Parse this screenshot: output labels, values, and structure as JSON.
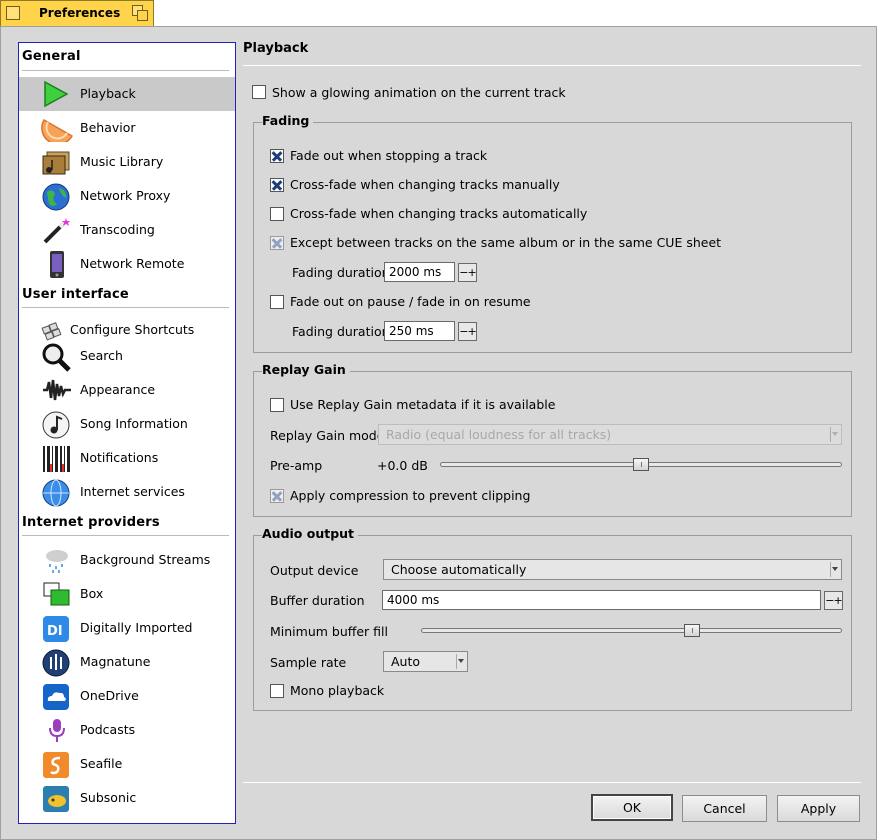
{
  "window": {
    "title": "Preferences"
  },
  "sidebar": {
    "sections": [
      {
        "title": "General",
        "items": [
          {
            "label": "Playback",
            "icon": "play-icon",
            "selected": true
          },
          {
            "label": "Behavior",
            "icon": "orange-slice-icon"
          },
          {
            "label": "Music Library",
            "icon": "music-folder-icon"
          },
          {
            "label": "Network Proxy",
            "icon": "globe-icon"
          },
          {
            "label": "Transcoding",
            "icon": "magic-wand-icon"
          },
          {
            "label": "Network Remote",
            "icon": "phone-icon"
          }
        ]
      },
      {
        "title": "User interface",
        "items": [
          {
            "label": "Configure Shortcuts",
            "icon": "keyboard-icon"
          },
          {
            "label": "Search",
            "icon": "magnifier-icon"
          },
          {
            "label": "Appearance",
            "icon": "waveform-icon"
          },
          {
            "label": "Song Information",
            "icon": "music-note-icon"
          },
          {
            "label": "Notifications",
            "icon": "barcode-icon"
          },
          {
            "label": "Internet services",
            "icon": "internet-globe-icon"
          }
        ]
      },
      {
        "title": "Internet providers",
        "items": [
          {
            "label": "Background Streams",
            "icon": "rain-cloud-icon"
          },
          {
            "label": "Box",
            "icon": "box-icon"
          },
          {
            "label": "Digitally Imported",
            "icon": "di-logo-icon"
          },
          {
            "label": "Magnatune",
            "icon": "magnatune-icon"
          },
          {
            "label": "OneDrive",
            "icon": "onedrive-icon"
          },
          {
            "label": "Podcasts",
            "icon": "podcast-icon"
          },
          {
            "label": "Seafile",
            "icon": "seafile-icon"
          },
          {
            "label": "Subsonic",
            "icon": "subsonic-icon"
          }
        ]
      }
    ]
  },
  "page": {
    "title": "Playback",
    "glowing_animation": {
      "label": "Show a glowing animation on the current track",
      "checked": false
    },
    "fading": {
      "title": "Fading",
      "fade_out_stop": {
        "label": "Fade out when stopping a track",
        "checked": true
      },
      "crossfade_manual": {
        "label": "Cross-fade when changing tracks manually",
        "checked": true
      },
      "crossfade_auto": {
        "label": "Cross-fade when changing tracks automatically",
        "checked": false
      },
      "except_album": {
        "label": "Except between tracks on the same album or in the same CUE sheet",
        "checked": true,
        "disabled": true
      },
      "duration_label": "Fading duration",
      "duration_value": "2000 ms",
      "fade_pause": {
        "label": "Fade out on pause / fade in on resume",
        "checked": false
      },
      "pause_duration_label": "Fading duration",
      "pause_duration_value": "250 ms",
      "spin_label": "−+"
    },
    "replay_gain": {
      "title": "Replay Gain",
      "use_metadata": {
        "label": "Use Replay Gain metadata if it is available",
        "checked": false
      },
      "mode_label": "Replay Gain mode",
      "mode_value": "Radio (equal loudness for all tracks)",
      "preamp_label": "Pre-amp",
      "preamp_value": "+0.0 dB",
      "preamp_level": 0.5,
      "compression": {
        "label": "Apply compression to prevent clipping",
        "checked": true,
        "disabled": true
      }
    },
    "audio_output": {
      "title": "Audio output",
      "device_label": "Output device",
      "device_value": "Choose automatically",
      "buffer_label": "Buffer duration",
      "buffer_value": "4000 ms",
      "min_fill_label": "Minimum buffer fill",
      "min_fill_level": 0.65,
      "sample_rate_label": "Sample rate",
      "sample_rate_value": "Auto",
      "mono": {
        "label": "Mono playback",
        "checked": false
      }
    }
  },
  "buttons": {
    "ok": "OK",
    "cancel": "Cancel",
    "apply": "Apply"
  }
}
